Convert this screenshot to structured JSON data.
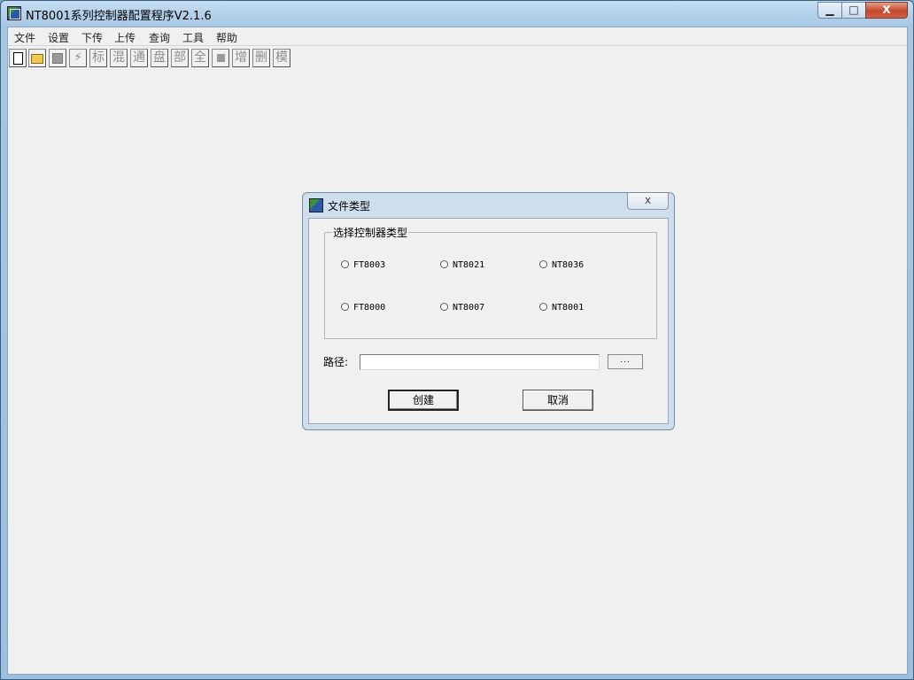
{
  "window": {
    "title": "NT8001系列控制器配置程序V2.1.6",
    "min_symbol": "▁",
    "max_symbol": "□",
    "close_symbol": "X"
  },
  "menu": [
    "文件",
    "设置",
    "下传",
    "上传",
    "查询",
    "工具",
    "帮助"
  ],
  "toolbar": {
    "text_buttons": [
      "标",
      "混",
      "通",
      "盘",
      "部",
      "全",
      "增",
      "删",
      "模"
    ],
    "lightning_symbol": "⚡"
  },
  "dialog": {
    "title": "文件类型",
    "close_symbol": "ⅹ",
    "group_title": "选择控制器类型",
    "options": [
      "FT8003",
      "NT8021",
      "NT8036",
      "FT8000",
      "NT8007",
      "NT8001"
    ],
    "path_label": "路径:",
    "path_value": "",
    "browse_label": "...",
    "create_label": "创建",
    "cancel_label": "取消"
  }
}
